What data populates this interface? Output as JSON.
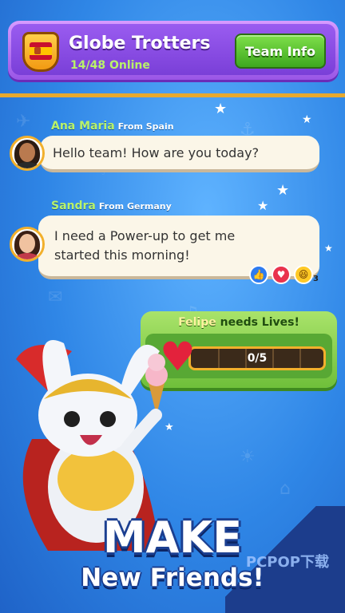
{
  "header": {
    "team_name": "Globe Trotters",
    "online_status": "14/48 Online",
    "team_info_label": "Team Info",
    "flag_icon": "spain-flag-icon"
  },
  "messages": [
    {
      "sender": "Ana Maria",
      "from_label": "From Spain",
      "text": "Hello team! How are you today?"
    },
    {
      "sender": "Sandra",
      "from_label": "From Germany",
      "text_line1": "I need a Power-up to get me",
      "text_line2": "started this morning!"
    }
  ],
  "reactions": {
    "icons": [
      "thumbs-up-icon",
      "heart-icon",
      "laugh-icon"
    ],
    "count": "3"
  },
  "lives_request": {
    "name": "Felipe",
    "suffix": "needs Lives!",
    "progress_text": "0/5",
    "progress_fraction": 0.0
  },
  "promo": {
    "headline": "MAKE",
    "subline": "New Friends!"
  },
  "watermark": "PCPOP下载",
  "colors": {
    "background": "#2f86e6",
    "header": "#7a3fd8",
    "green_button": "#3ea81f",
    "accent": "#e8a92e"
  }
}
